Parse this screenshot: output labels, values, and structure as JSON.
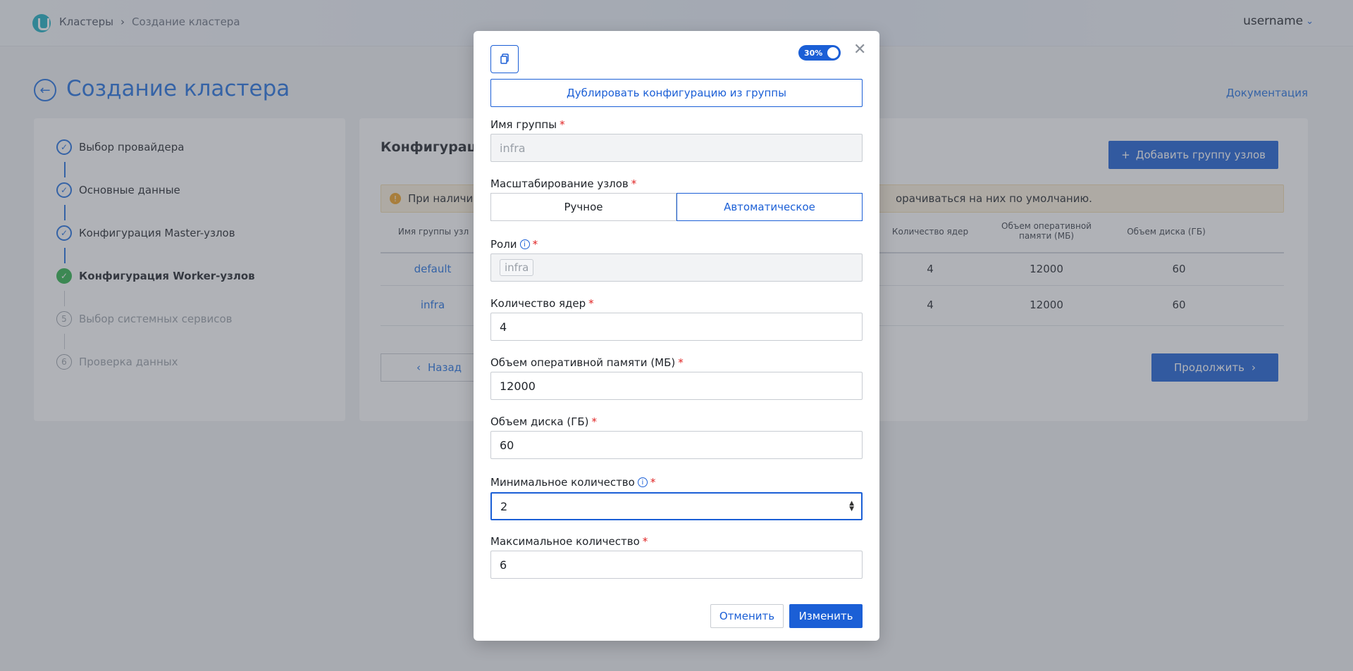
{
  "header": {
    "breadcrumb": [
      "Кластеры",
      "Создание кластера"
    ],
    "separator": "›",
    "username": "username"
  },
  "page": {
    "title": "Создание кластера",
    "doc_link": "Документация"
  },
  "steps": [
    {
      "label": "Выбор провайдера",
      "marker": "✓"
    },
    {
      "label": "Основные данные",
      "marker": "✓"
    },
    {
      "label": "Конфигурация Master-узлов",
      "marker": "✓"
    },
    {
      "label": "Конфигурация Worker-узлов",
      "marker": "✓"
    },
    {
      "label": "Выбор системных сервисов",
      "marker": "5"
    },
    {
      "label": "Проверка данных",
      "marker": "6"
    }
  ],
  "config": {
    "title": "Конфигурация",
    "add_group": "Добавить группу узлов",
    "warning_start": "При наличии",
    "warning_end": "орачиваться на них по умолчанию.",
    "columns": {
      "name": "Имя группы узл",
      "cores": "Количество ядер",
      "ram": "Объем оперативной памяти (МБ)",
      "disk": "Объем диска (ГБ)"
    },
    "rows": [
      {
        "name": "default",
        "cores": "4",
        "ram": "12000",
        "disk": "60"
      },
      {
        "name": "infra",
        "cores": "4",
        "ram": "12000",
        "disk": "60"
      }
    ],
    "back": "Назад",
    "continue": "Продолжить"
  },
  "modal": {
    "toggle_label": "30%",
    "duplicate": "Дублировать конфигурацию из группы",
    "group_name_label": "Имя группы",
    "group_name_value": "infra",
    "scaling_label": "Масштабирование узлов",
    "scaling_manual": "Ручное",
    "scaling_auto": "Автоматическое",
    "roles_label": "Роли",
    "roles_tag": "infra",
    "cores_label": "Количество ядер",
    "cores_value": "4",
    "ram_label": "Объем оперативной памяти (МБ)",
    "ram_value": "12000",
    "disk_label": "Объем диска (ГБ)",
    "disk_value": "60",
    "min_label": "Минимальное количество",
    "min_value": "2",
    "max_label": "Максимальное количество",
    "max_value": "6",
    "cancel": "Отменить",
    "save": "Изменить",
    "required_mark": "*"
  },
  "colors": {
    "primary": "#1b5fd6",
    "success": "#2db34a",
    "warning_bg": "#fbf1dc"
  }
}
